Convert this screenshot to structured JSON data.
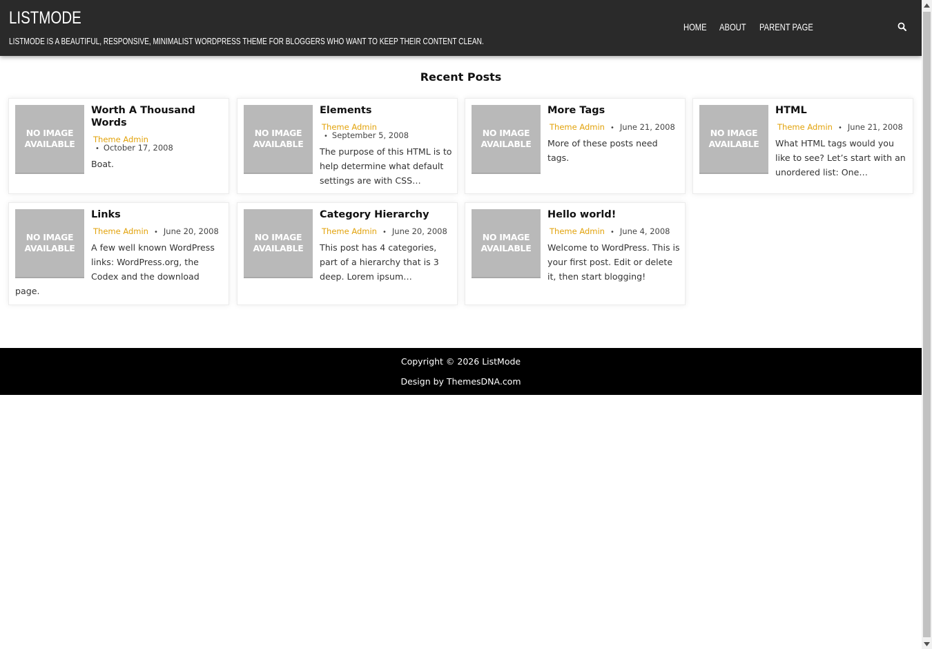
{
  "header": {
    "site_title": "LISTMODE",
    "site_description": "LISTMODE IS A BEAUTIFUL, RESPONSIVE, MINIMALIST WORDPRESS THEME FOR BLOGGERS WHO WANT TO KEEP THEIR CONTENT CLEAN.",
    "nav": [
      {
        "label": "HOME"
      },
      {
        "label": "ABOUT"
      },
      {
        "label": "PARENT PAGE"
      }
    ],
    "search_icon": "search-icon"
  },
  "main": {
    "section_title": "Recent Posts",
    "no_image_line1": "NO IMAGE",
    "no_image_line2": "AVAILABLE",
    "posts": [
      {
        "title": "Worth A Thousand Words",
        "author": "Theme Admin",
        "date": "October 17, 2008",
        "excerpt": "Boat."
      },
      {
        "title": "Elements",
        "author": "Theme Admin",
        "date": "September 5, 2008",
        "excerpt": "The purpose of this HTML is to help determine what default settings are with CSS…"
      },
      {
        "title": "More Tags",
        "author": "Theme Admin",
        "date": "June 21, 2008",
        "excerpt": "More of these posts need tags."
      },
      {
        "title": "HTML",
        "author": "Theme Admin",
        "date": "June 21, 2008",
        "excerpt": "What HTML tags would you like to see? Let’s start with an unordered list: One…"
      },
      {
        "title": "Links",
        "author": "Theme Admin",
        "date": "June 20, 2008",
        "excerpt_line1": "A few well known WordPress links: WordPress.org, the Codex and the download",
        "excerpt_line2": "page."
      },
      {
        "title": "Category Hierarchy",
        "author": "Theme Admin",
        "date": "June 20, 2008",
        "excerpt": "This post has 4 categories, part of a hierarchy that is 3 deep. Lorem ipsum…"
      },
      {
        "title": "Hello world!",
        "author": "Theme Admin",
        "date": "June 4, 2008",
        "excerpt": "Welcome to WordPress. This is your first post. Edit or delete it, then start blogging!"
      }
    ]
  },
  "footer": {
    "copyright_prefix": "Copyright © 2026 ",
    "copyright_site": "ListMode",
    "design_prefix": "Design by ",
    "design_link": "ThemesDNA.com"
  },
  "colors": {
    "header_bg": "#2a2a2a",
    "accent": "#e2a20a",
    "footer_bg": "#000000",
    "placeholder_bg": "#b9b9b9"
  }
}
